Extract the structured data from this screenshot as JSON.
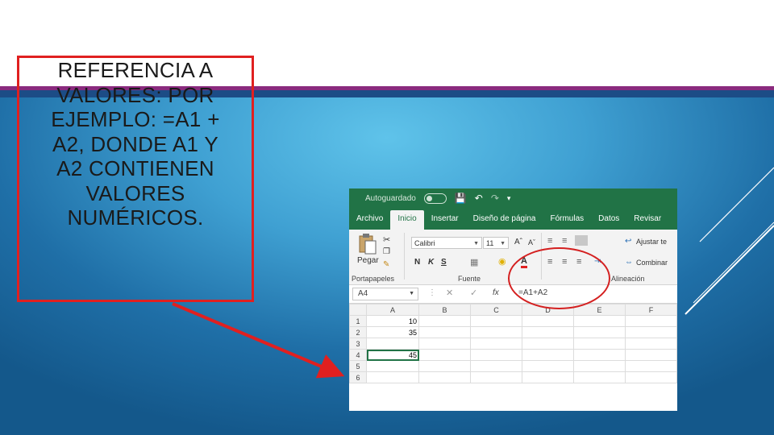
{
  "slide": {
    "text_lines": [
      "REFERENCIA A",
      "VALORES: POR",
      "EJEMPLO: =A1 +",
      "A2, DONDE A1 Y",
      "A2 CONTIENEN",
      "VALORES",
      "NUMÉRICOS."
    ],
    "colors": {
      "accent_red": "#e02020",
      "stripe_purple": "#8a2a7e",
      "stripe_navy": "#1c4c86",
      "excel_green": "#217346"
    }
  },
  "excel": {
    "qat": {
      "autosave_label": "Autoguardado"
    },
    "tabs": [
      "Archivo",
      "Inicio",
      "Insertar",
      "Diseño de página",
      "Fórmulas",
      "Datos",
      "Revisar"
    ],
    "active_tab": "Inicio",
    "ribbon": {
      "paste_label": "Pegar",
      "clipboard_group": "Portapapeles",
      "font_name": "Calibri",
      "font_size": "11",
      "bold": "N",
      "italic": "K",
      "underline": "S",
      "font_group": "Fuente",
      "wrap_text": "Ajustar te",
      "merge": "Combinar",
      "alignment_group": "Alineación"
    },
    "formula_bar": {
      "name_box": "A4",
      "fx": "fx",
      "formula": "=A1+A2"
    },
    "columns": [
      "A",
      "B",
      "C",
      "D",
      "E",
      "F"
    ],
    "rows": [
      {
        "n": "1",
        "a": "10"
      },
      {
        "n": "2",
        "a": "35"
      },
      {
        "n": "3",
        "a": ""
      },
      {
        "n": "4",
        "a": "45"
      },
      {
        "n": "5",
        "a": ""
      },
      {
        "n": "6",
        "a": ""
      }
    ]
  }
}
